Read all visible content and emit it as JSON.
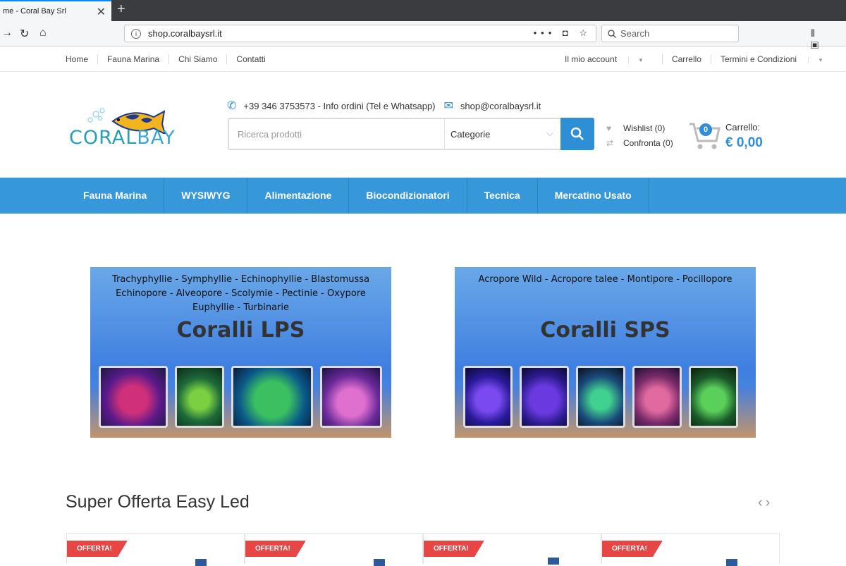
{
  "browser": {
    "tab_title": "me - Coral Bay Srl",
    "url": "shop.coralbaysrl.it",
    "search_placeholder": "Search"
  },
  "topbar": {
    "left": [
      "Home",
      "Fauna Marina",
      "Chi Siamo",
      "Contatti"
    ],
    "right": [
      "Il mio account",
      "Carrello",
      "Termini e Condizioni"
    ]
  },
  "header": {
    "logo_part1": "CORAL",
    "logo_part2": "BAY",
    "phone": "+39 346 3753573 - Info ordini (Tel e Whatsapp)",
    "email": "shop@coralbaysrl.it",
    "search_placeholder": "Ricerca prodotti",
    "category_label": "Categorie",
    "wishlist": "Wishlist (0)",
    "compare": "Confronta (0)",
    "cart_count": "0",
    "cart_label": "Carrello:",
    "cart_total": "€ 0,00"
  },
  "mainnav": [
    "Fauna Marina",
    "WYSIWYG",
    "Alimentazione",
    "Biocondizionatori",
    "Tecnica",
    "Mercatino Usato"
  ],
  "banners": [
    {
      "subtitle_lines": [
        "Trachyphyllie - Symphyllie - Echinophyllie - Blastomussa",
        "Echinopore - Alveopore - Scolymie - Pectinie - Oxypore",
        "Euphyllie - Turbinarie"
      ],
      "title": "Coralli LPS"
    },
    {
      "subtitle_lines": [
        "Acropore Wild - Acropore talee - Montipore - Pocillopore"
      ],
      "title": "Coralli SPS"
    }
  ],
  "offers": {
    "title": "Super Offerta Easy Led",
    "badge": "OFFERTA!"
  },
  "colors": {
    "accent": "#3698d8",
    "badge": "#e84545"
  }
}
